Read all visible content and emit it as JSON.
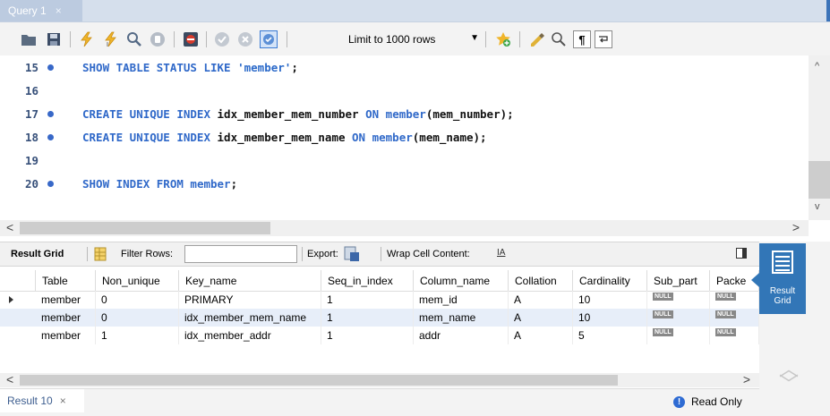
{
  "query_tab": {
    "label": "Query 1",
    "close": "×"
  },
  "toolbar": {
    "limit_label": "Limit to 1000 rows",
    "icons": [
      "open-folder-icon",
      "save-icon",
      "execute-icon",
      "execute-current-icon",
      "explain-icon",
      "stop-icon",
      "toggle-error-icon",
      "commit-icon",
      "rollback-icon",
      "autocommit-icon",
      "limit-dropdown",
      "add-snippet-icon",
      "beautify-icon",
      "find-icon",
      "invisible-chars-icon",
      "wrap-lines-icon"
    ]
  },
  "editor": {
    "lines": [
      {
        "num": "15",
        "dot": true,
        "tokens": [
          {
            "t": "SHOW TABLE STATUS LIKE ",
            "c": "kw"
          },
          {
            "t": "'member'",
            "c": "str"
          },
          {
            "t": ";",
            "c": "id"
          }
        ]
      },
      {
        "num": "16",
        "dot": false,
        "tokens": []
      },
      {
        "num": "17",
        "dot": true,
        "tokens": [
          {
            "t": "CREATE UNIQUE INDEX ",
            "c": "kw"
          },
          {
            "t": "idx_member_mem_number ",
            "c": "id"
          },
          {
            "t": "ON ",
            "c": "kw"
          },
          {
            "t": "member",
            "c": "kw"
          },
          {
            "t": "(mem_number);",
            "c": "id"
          }
        ]
      },
      {
        "num": "18",
        "dot": true,
        "tokens": [
          {
            "t": "CREATE UNIQUE INDEX ",
            "c": "kw"
          },
          {
            "t": "idx_member_mem_name ",
            "c": "id"
          },
          {
            "t": "ON ",
            "c": "kw"
          },
          {
            "t": "member",
            "c": "kw"
          },
          {
            "t": "(mem_name);",
            "c": "id"
          }
        ]
      },
      {
        "num": "19",
        "dot": false,
        "tokens": []
      },
      {
        "num": "20",
        "dot": true,
        "tokens": [
          {
            "t": "SHOW INDEX FROM ",
            "c": "kw"
          },
          {
            "t": "member",
            "c": "kw"
          },
          {
            "t": ";",
            "c": "id"
          }
        ]
      }
    ]
  },
  "result_toolbar": {
    "result_grid_label": "Result Grid",
    "filter_label": "Filter Rows:",
    "filter_value": "",
    "export_label": "Export:",
    "wrap_label": "Wrap Cell Content:"
  },
  "grid": {
    "columns": [
      "Table",
      "Non_unique",
      "Key_name",
      "Seq_in_index",
      "Column_name",
      "Collation",
      "Cardinality",
      "Sub_part",
      "Packe"
    ],
    "rows": [
      [
        "member",
        "0",
        "PRIMARY",
        "1",
        "mem_id",
        "A",
        "10",
        "NULL",
        "NULL"
      ],
      [
        "member",
        "0",
        "idx_member_mem_name",
        "1",
        "mem_name",
        "A",
        "10",
        "NULL",
        "NULL"
      ],
      [
        "member",
        "1",
        "idx_member_addr",
        "1",
        "addr",
        "A",
        "5",
        "NULL",
        "NULL"
      ]
    ]
  },
  "side_panel": {
    "result_grid_line1": "Result",
    "result_grid_line2": "Grid"
  },
  "status": {
    "result_tab": "Result 10",
    "close": "×",
    "read_only": "Read Only",
    "info_glyph": "!"
  }
}
